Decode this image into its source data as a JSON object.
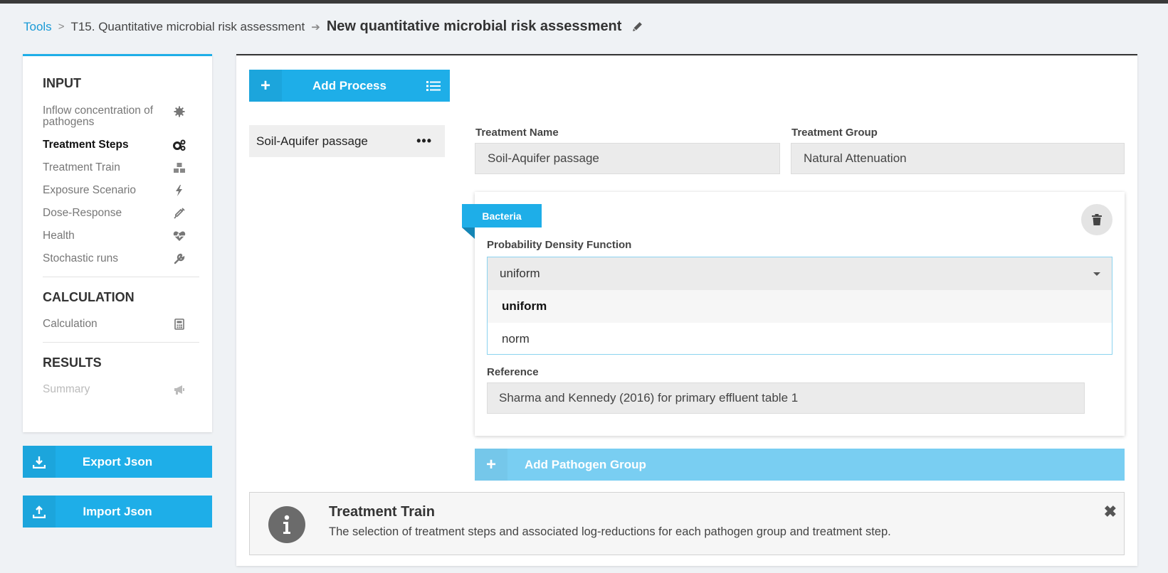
{
  "breadcrumb": {
    "tools": "Tools",
    "tool": "T15. Quantitative microbial risk assessment",
    "current": "New quantitative microbial risk assessment"
  },
  "sidebar": {
    "input_heading": "INPUT",
    "input_items": [
      {
        "label": "Inflow concentration of pathogens",
        "icon": "sun-gear-icon",
        "state": "normal"
      },
      {
        "label": "Treatment Steps",
        "icon": "gears-icon",
        "state": "active"
      },
      {
        "label": "Treatment Train",
        "icon": "cubes-icon",
        "state": "normal"
      },
      {
        "label": "Exposure Scenario",
        "icon": "bolt-icon",
        "state": "normal"
      },
      {
        "label": "Dose-Response",
        "icon": "syringe-icon",
        "state": "normal"
      },
      {
        "label": "Health",
        "icon": "heartbeat-icon",
        "state": "normal"
      },
      {
        "label": "Stochastic runs",
        "icon": "wrench-icon",
        "state": "normal"
      }
    ],
    "calc_heading": "CALCULATION",
    "calc_item": "Calculation",
    "results_heading": "RESULTS",
    "results_item": "Summary"
  },
  "buttons": {
    "export": "Export Json",
    "import": "Import Json",
    "add_process": "Add Process",
    "add_pathogen": "Add Pathogen Group"
  },
  "process": {
    "item_label": "Soil-Aquifer passage",
    "menu": "•••"
  },
  "form": {
    "name_label": "Treatment Name",
    "name_value": "Soil-Aquifer passage",
    "group_label": "Treatment Group",
    "group_value": "Natural Attenuation"
  },
  "pathogen": {
    "tag": "Bacteria",
    "pdf_label": "Probability Density Function",
    "pdf_selected": "uniform",
    "pdf_options": [
      "uniform",
      "norm"
    ],
    "reference_label": "Reference",
    "reference_value": "Sharma and Kennedy (2016) for primary effluent table 1"
  },
  "info": {
    "title": "Treatment Train",
    "text": "The selection of treatment steps and associated log-reductions for each pathogen group and treatment step.",
    "close": "✖"
  },
  "colors": {
    "accent": "#1eaee8",
    "accent_light": "#79cef2",
    "link": "#1a9ad6"
  }
}
